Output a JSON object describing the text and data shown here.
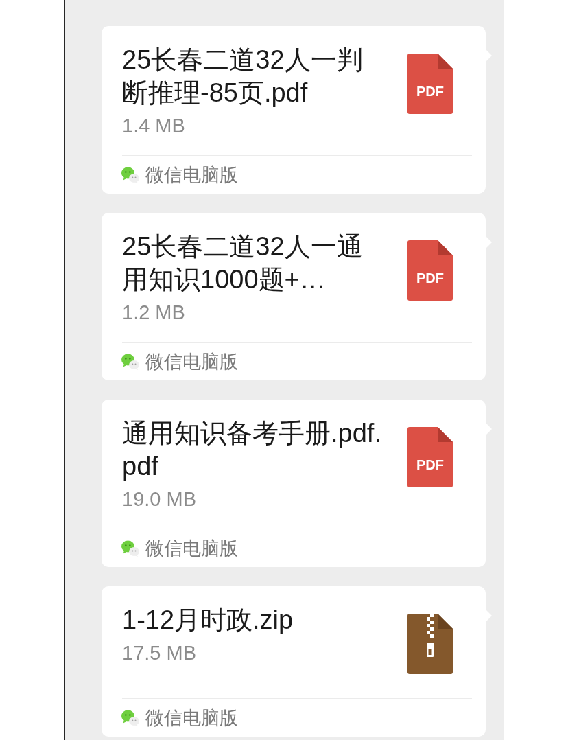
{
  "files": [
    {
      "kind": "pdf",
      "name_lines": [
        "25长春二道32人一判",
        "断推理-85页.pdf"
      ],
      "size": "1.4 MB",
      "icon_label": "PDF",
      "source": "微信电脑版"
    },
    {
      "kind": "pdf",
      "name_lines": [
        "25长春二道32人一通",
        "用知识1000题+…"
      ],
      "size": "1.2 MB",
      "icon_label": "PDF",
      "source": "微信电脑版"
    },
    {
      "kind": "pdf",
      "name_lines": [
        "通用知识备考手册.pdf.",
        "pdf"
      ],
      "size": "19.0 MB",
      "icon_label": "PDF",
      "source": "微信电脑版"
    },
    {
      "kind": "zip",
      "name_lines": [
        "1-12月时政.zip"
      ],
      "size": "17.5 MB",
      "source": "微信电脑版"
    }
  ]
}
